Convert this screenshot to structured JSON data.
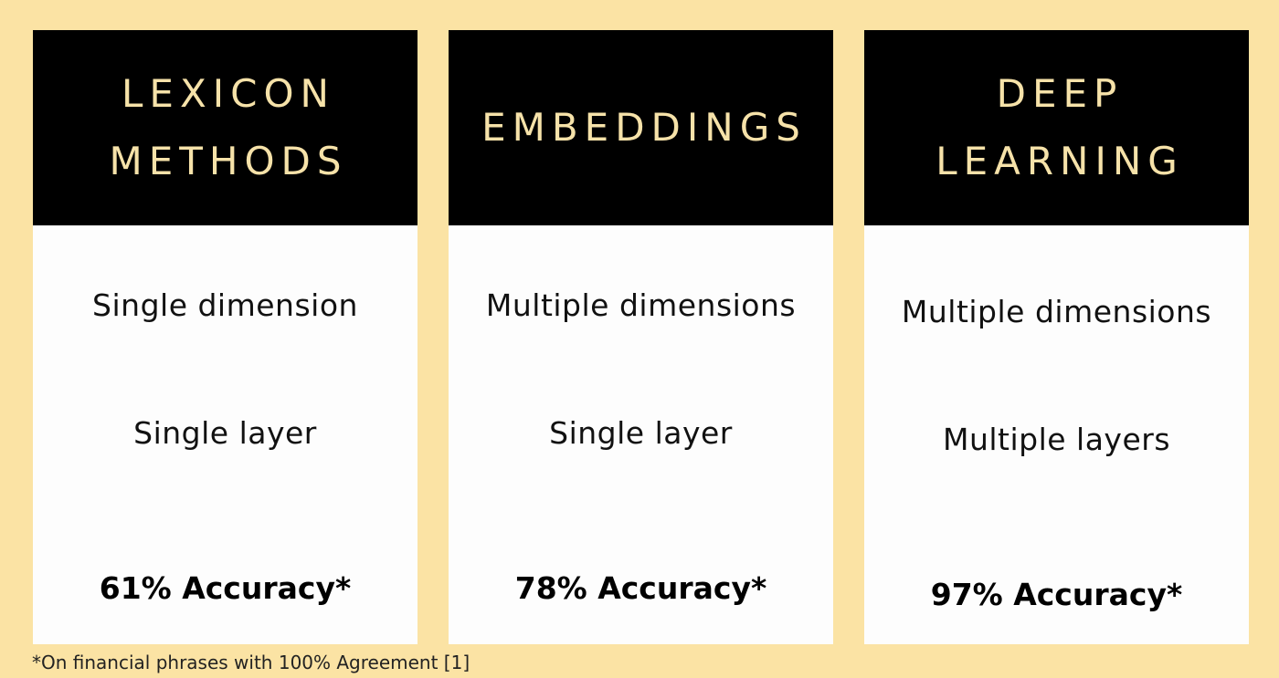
{
  "background_color": "#fbe3a4",
  "header_color": "#000000",
  "title_color": "#f6e2a9",
  "cards": [
    {
      "title_line1": "LEXICON",
      "title_line2": "METHODS",
      "dimension": "Single dimension",
      "layer": "Single layer",
      "accuracy": "61% Accuracy*"
    },
    {
      "title_line1": "EMBEDDINGS",
      "title_line2": "",
      "dimension": "Multiple dimensions",
      "layer": "Single layer",
      "accuracy": "78% Accuracy*"
    },
    {
      "title_line1": "DEEP",
      "title_line2": "LEARNING",
      "dimension": "Multiple dimensions",
      "layer": "Multiple layers",
      "accuracy": "97% Accuracy*"
    }
  ],
  "footnote": "*On financial phrases with 100% Agreement [1]"
}
